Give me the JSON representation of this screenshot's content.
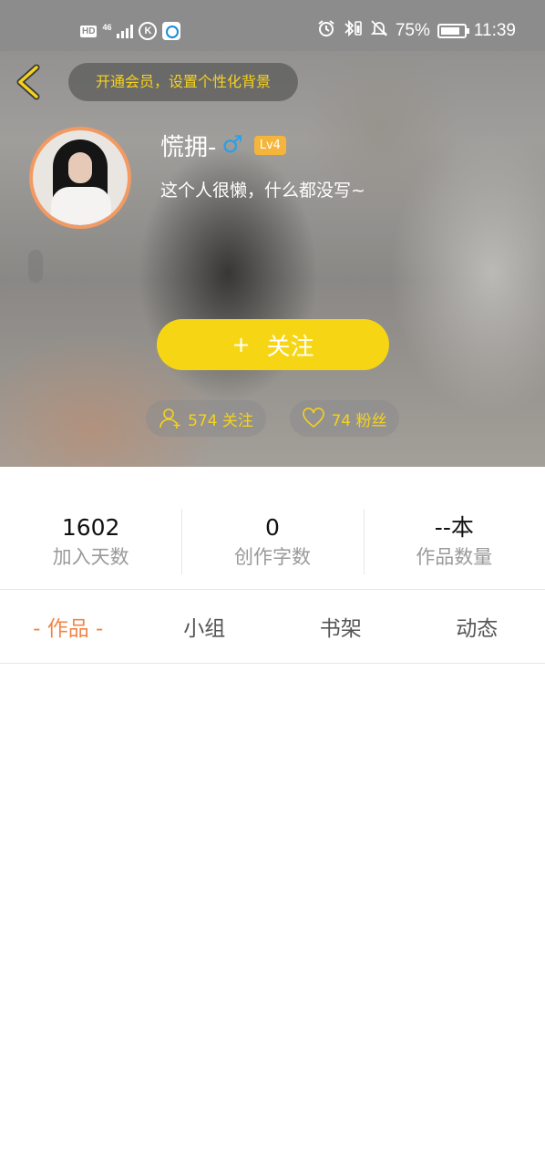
{
  "status_bar": {
    "hd": "HD",
    "network": "46",
    "k_icon": "K",
    "battery": "75%",
    "time": "11:39"
  },
  "header": {
    "vip_prompt": "开通会员，设置个性化背景",
    "username": "慌拥-",
    "gender_symbol": "♂",
    "level": "Lv4",
    "bio": "这个人很懒，什么都没写~",
    "follow_plus": "+",
    "follow_label": "关注",
    "following_label": "574 关注",
    "fans_label": "74 粉丝"
  },
  "stats": [
    {
      "value": "1602",
      "label": "加入天数"
    },
    {
      "value": "0",
      "label": "创作字数"
    },
    {
      "value": "--本",
      "label": "作品数量"
    }
  ],
  "tabs": [
    {
      "label": "- 作品 -",
      "active": true
    },
    {
      "label": "小组",
      "active": false
    },
    {
      "label": "书架",
      "active": false
    },
    {
      "label": "动态",
      "active": false
    }
  ],
  "colors": {
    "accent_yellow": "#f6d614",
    "active_tab": "#f0854a",
    "avatar_ring": "#f39a63",
    "gender_blue": "#2aa0e6",
    "level_badge": "#f5b53a"
  }
}
